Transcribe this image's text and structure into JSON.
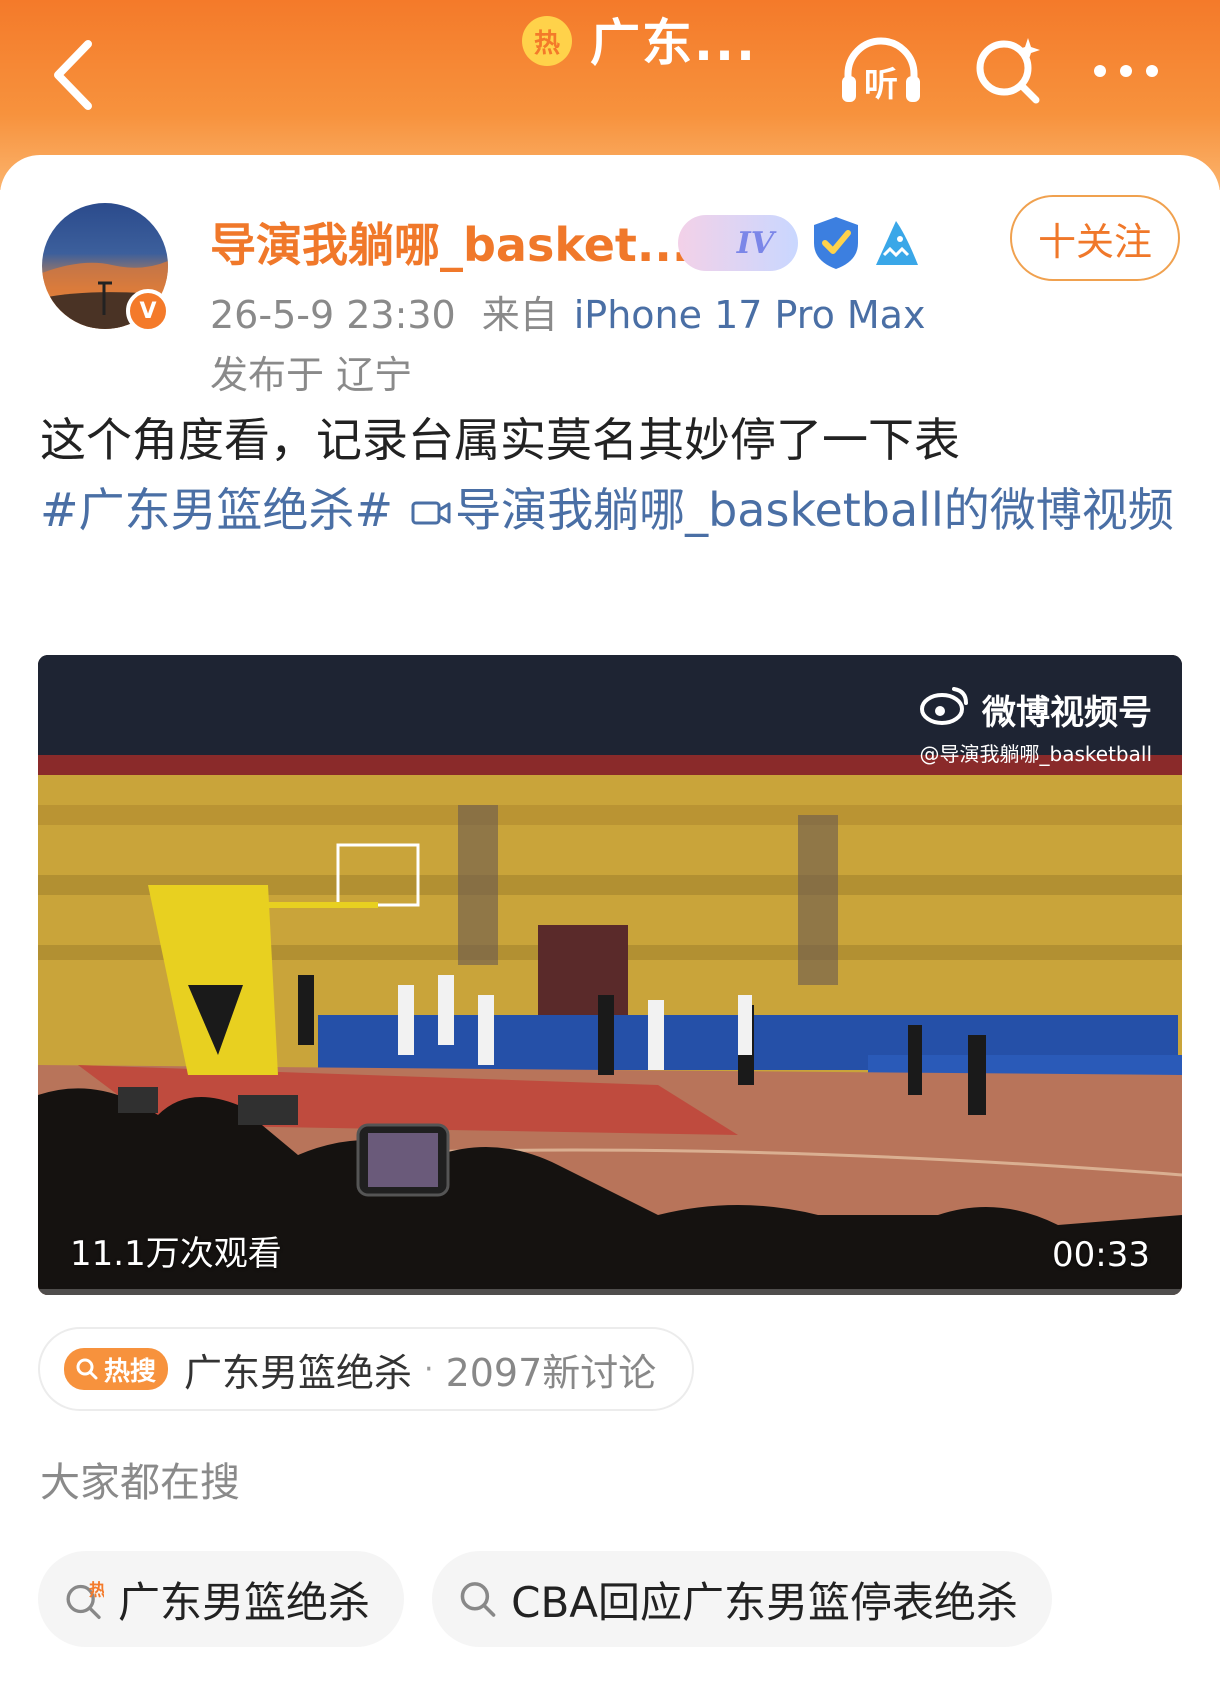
{
  "header": {
    "hot_badge": "热",
    "title": "广东...",
    "listen_label": "听",
    "accent_color": "#f47a2a"
  },
  "post": {
    "username": "导演我躺哪_basket...",
    "level_badge": "IV",
    "follow_label": "十关注",
    "timestamp": "26-5-9 23:30",
    "source_prefix": "来自",
    "device": "iPhone 17 Pro Max",
    "location": "发布于 辽宁",
    "text": "这个角度看，记录台属实莫名其妙停了一下表",
    "topic": "#广东男篮绝杀#",
    "video_link": "导演我躺哪_basketball的微博视频",
    "link_color": "#4a6fa5"
  },
  "video": {
    "watermark_brand": "微博视频号",
    "watermark_user": "@导演我躺哪_basketball",
    "views": "11.1万次观看",
    "duration": "00:33"
  },
  "hot_search": {
    "tag": "热搜",
    "topic": "广东男篮绝杀",
    "separator": "·",
    "count": "2097新讨论"
  },
  "related": {
    "title": "大家都在搜",
    "items": [
      {
        "label": "广东男篮绝杀",
        "icon": "hot-search-icon"
      },
      {
        "label": "CBA回应广东男篮停表绝杀",
        "icon": "search-icon"
      }
    ]
  }
}
